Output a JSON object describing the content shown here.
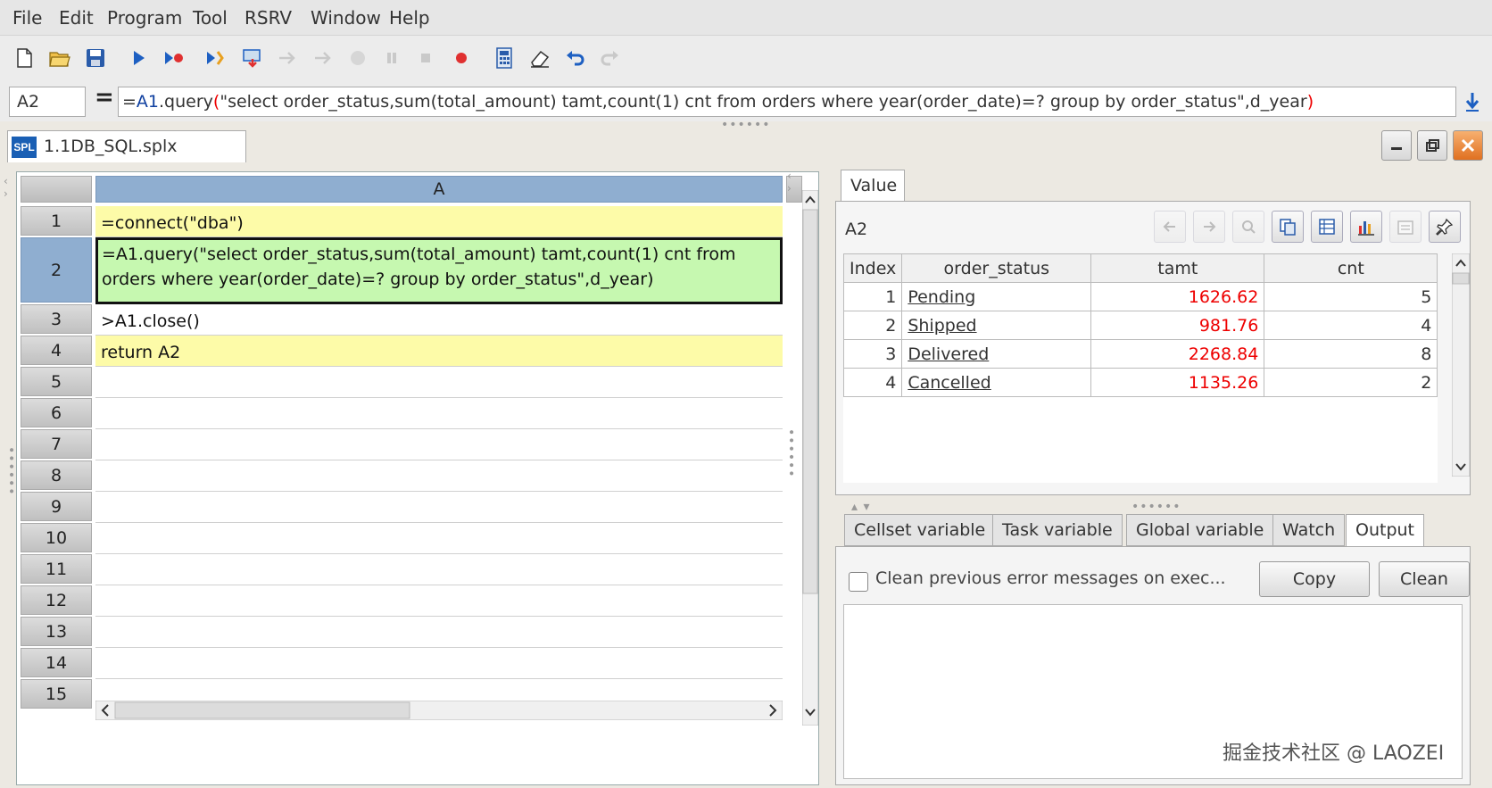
{
  "menu": [
    {
      "label": "File"
    },
    {
      "label": "Edit"
    },
    {
      "label": "Program"
    },
    {
      "label": "Tool"
    },
    {
      "label": "RSRV"
    },
    {
      "label": "Window"
    },
    {
      "label": "Help"
    }
  ],
  "formula": {
    "cell_ref": "A2",
    "equals": "=",
    "p1": "=",
    "p2": "A1",
    "p3": ".query",
    "p4": "(",
    "p5": "\"select order_status,sum(total_amount) tamt,count(1) cnt from orders where year(order_date)=? group by order_status\",d_year",
    "p6": ")"
  },
  "file_tab": {
    "logo": "SPL",
    "name": "1.1DB_SQL.splx"
  },
  "grid": {
    "column_header": "A",
    "rows": [
      {
        "num": "1",
        "text": "=connect(\"dba\")"
      },
      {
        "num": "2",
        "text": "=A1.query(\"select order_status,sum(total_amount) tamt,count(1) cnt from orders where year(order_date)=? group by order_status\",d_year)"
      },
      {
        "num": "3",
        "text": ">A1.close()"
      },
      {
        "num": "4",
        "text": "return A2"
      },
      {
        "num": "5",
        "text": ""
      },
      {
        "num": "6",
        "text": ""
      },
      {
        "num": "7",
        "text": ""
      },
      {
        "num": "8",
        "text": ""
      },
      {
        "num": "9",
        "text": ""
      },
      {
        "num": "10",
        "text": ""
      },
      {
        "num": "11",
        "text": ""
      },
      {
        "num": "12",
        "text": ""
      },
      {
        "num": "13",
        "text": ""
      },
      {
        "num": "14",
        "text": ""
      },
      {
        "num": "15",
        "text": ""
      }
    ]
  },
  "value_panel": {
    "tab": "Value",
    "name": "A2",
    "columns": [
      "Index",
      "order_status",
      "tamt",
      "cnt"
    ],
    "rows": [
      {
        "index": "1",
        "status": "Pending",
        "tamt": "1626.62",
        "cnt": "5"
      },
      {
        "index": "2",
        "status": "Shipped",
        "tamt": "981.76",
        "cnt": "4"
      },
      {
        "index": "3",
        "status": "Delivered",
        "tamt": "2268.84",
        "cnt": "8"
      },
      {
        "index": "4",
        "status": "Cancelled",
        "tamt": "1135.26",
        "cnt": "2"
      }
    ]
  },
  "bottom_tabs": [
    "Cellset variable",
    "Task variable",
    "Global variable",
    "Watch",
    "Output"
  ],
  "output": {
    "checkbox_label": "Clean previous error messages on exec...",
    "copy_label": "Copy",
    "clean_label": "Clean"
  },
  "watermark": "掘金技术社区 @ LAOZEI",
  "colors": {
    "column_header": "#8faed0",
    "yellow_cell": "#fdfba8",
    "green_cell": "#c6f8b0",
    "red_value": "#ee0000"
  }
}
